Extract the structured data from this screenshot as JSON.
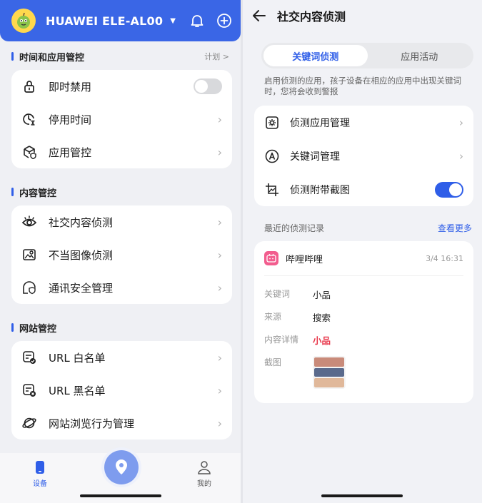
{
  "left": {
    "header": {
      "device_name": "HUAWEI ELE-AL00",
      "caret": "▼",
      "icons": [
        "bell-icon",
        "add-circle-icon"
      ]
    },
    "sections": [
      {
        "title": "时间和应用管控",
        "link": "计划 >",
        "items": [
          {
            "label": "即时禁用",
            "icon": "lock-icon",
            "control": "toggle-off"
          },
          {
            "label": "停用时间",
            "icon": "clock-hourglass-icon",
            "control": "chevron"
          },
          {
            "label": "应用管控",
            "icon": "app-shield-icon",
            "control": "chevron"
          }
        ]
      },
      {
        "title": "内容管控",
        "items": [
          {
            "label": "社交内容侦测",
            "icon": "eye-icon",
            "control": "chevron"
          },
          {
            "label": "不当图像侦测",
            "icon": "image-search-icon",
            "control": "chevron"
          },
          {
            "label": "通讯安全管理",
            "icon": "chat-shield-icon",
            "control": "chevron"
          }
        ]
      },
      {
        "title": "网站管控",
        "items": [
          {
            "label": "URL 白名单",
            "icon": "list-check-icon",
            "control": "chevron"
          },
          {
            "label": "URL 黑名单",
            "icon": "list-block-icon",
            "control": "chevron"
          },
          {
            "label": "网站浏览行为管理",
            "icon": "planet-icon",
            "control": "chevron"
          }
        ]
      }
    ],
    "bottom_nav": {
      "device_label": "设备",
      "mine_label": "我的"
    },
    "chevron": "›"
  },
  "right": {
    "title": "社交内容侦测",
    "tabs": [
      {
        "label": "关键词侦测",
        "active": true
      },
      {
        "label": "应用活动",
        "active": false
      }
    ],
    "description": "启用侦测的应用，孩子设备在相应的应用中出现关键词时，您将会收到警报",
    "settings": [
      {
        "label": "侦测应用管理",
        "icon": "settings-box-icon",
        "control": "chevron"
      },
      {
        "label": "关键词管理",
        "icon": "letter-a-icon",
        "control": "chevron"
      },
      {
        "label": "侦测附带截图",
        "icon": "screenshot-icon",
        "control": "toggle-on"
      }
    ],
    "records": {
      "heading": "最近的侦测记录",
      "more": "查看更多",
      "item": {
        "app_name": "哔哩哔哩",
        "time": "3/4 16:31",
        "fields": [
          {
            "key": "关键词",
            "value": "小品"
          },
          {
            "key": "来源",
            "value": "搜索"
          },
          {
            "key": "内容详情",
            "value": "小品"
          }
        ],
        "screenshot_label": "截图"
      }
    },
    "chevron": "›"
  },
  "colors": {
    "accent": "#2f5ee8",
    "header_blue": "#3a66e6",
    "highlight_red": "#e8364a"
  }
}
